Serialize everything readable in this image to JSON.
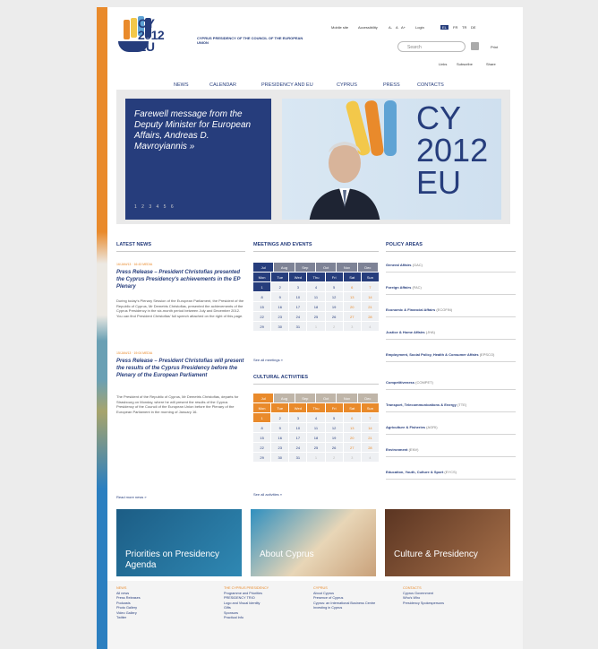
{
  "header": {
    "logo_text": "CY 2012 EU",
    "tagline": "CYPRUS PRESIDENCY OF THE COUNCIL OF THE EUROPEAN UNION",
    "util_links": [
      "Mobile site",
      "Accessibility",
      "A-",
      "A",
      "A+",
      "Login",
      "EL",
      "FR",
      "TR",
      "DE"
    ],
    "search_placeholder": "Search",
    "print_label": "Print",
    "sub_links": [
      "Links",
      "Subscribe",
      "Share"
    ]
  },
  "nav": [
    "NEWS",
    "CALENDAR",
    "PRESIDENCY AND EU",
    "CYPRUS",
    "PRESS",
    "CONTACTS"
  ],
  "hero": {
    "title": "Farewell message from the Deputy Minister for European Affairs, Andreas D. Mavroyiannis »",
    "pager": "1 2 3 4 5 6",
    "badge": "CY 2012 EU"
  },
  "latest_news": {
    "heading": "LATEST NEWS",
    "items": [
      {
        "date": "16/JAN/13 · 16:43 MEDIA",
        "title": "Press Release – President Christofias presented the Cyprus Presidency's achievements in the EP Plenary",
        "body": "During today's Plenary Session of the European Parliament, the President of the Republic of Cyprus, Mr Demetris Christofias, presented the achievements of the Cyprus Presidency in the six-month period between July and December 2012. You can find President Christofias' full speech attached on the right of this page."
      },
      {
        "date": "15/JAN/13 · 19:04 MEDIA",
        "title": "Press Release – President Christofias will present the results of the Cyprus Presidency before the Plenary of the European Parliament",
        "body": "The President of the Republic of Cyprus, Mr Demetris Christofias, departs for Strasbourg on Monday, where he will present the results of the Cyprus Presidency of the Council of the European Union before the Plenary of the European Parliament in the morning of January 16."
      }
    ],
    "read_more": "Read more news »"
  },
  "meetings": {
    "heading": "MEETINGS AND EVENTS",
    "months": [
      "Jul",
      "Aug",
      "Sep",
      "Oct",
      "Nov",
      "Dec"
    ],
    "days": [
      "Mon",
      "Tue",
      "Wed",
      "Thu",
      "Fri",
      "Sat",
      "Sun"
    ],
    "cells": [
      "1",
      "2",
      "3",
      "4",
      "5",
      "6",
      "7",
      "8",
      "9",
      "10",
      "11",
      "12",
      "13",
      "14",
      "15",
      "16",
      "17",
      "18",
      "19",
      "20",
      "21",
      "22",
      "23",
      "24",
      "25",
      "26",
      "27",
      "28",
      "29",
      "30",
      "31",
      "1",
      "2",
      "3",
      "4"
    ],
    "see_all": "See all meetings »"
  },
  "cultural": {
    "heading": "CULTURAL ACTIVITIES",
    "months": [
      "Jul",
      "Aug",
      "Sep",
      "Oct",
      "Nov",
      "Dec"
    ],
    "days": [
      "Mon",
      "Tue",
      "Wed",
      "Thu",
      "Fri",
      "Sat",
      "Sun"
    ],
    "cells": [
      "1",
      "2",
      "3",
      "4",
      "5",
      "6",
      "7",
      "8",
      "9",
      "10",
      "11",
      "12",
      "13",
      "14",
      "15",
      "16",
      "17",
      "18",
      "19",
      "20",
      "21",
      "22",
      "23",
      "24",
      "25",
      "26",
      "27",
      "28",
      "29",
      "30",
      "31",
      "1",
      "2",
      "3",
      "4"
    ],
    "see_all": "See all activities »"
  },
  "policy": {
    "heading": "POLICY AREAS",
    "items": [
      {
        "name": "General Affairs",
        "code": "(GAC)"
      },
      {
        "name": "Foreign Affairs",
        "code": "(FAC)"
      },
      {
        "name": "Economic & Financial Affairs",
        "code": "(ECOFIN)"
      },
      {
        "name": "Justice & Home Affairs",
        "code": "(JHA)"
      },
      {
        "name": "Employment, Social Policy, Health & Consumer Affairs",
        "code": "(EPSCO)"
      },
      {
        "name": "Competitiveness",
        "code": "(COMPET)"
      },
      {
        "name": "Transport, Telecommunications & Energy",
        "code": "(TTE)"
      },
      {
        "name": "Agriculture & Fisheries",
        "code": "(AGRI)"
      },
      {
        "name": "Environment",
        "code": "(ENV)"
      },
      {
        "name": "Education, Youth, Culture & Sport",
        "code": "(EYCS)"
      }
    ]
  },
  "tiles": [
    {
      "label": "Priorities on Presidency Agenda",
      "color": "#1f6e9a"
    },
    {
      "label": "About Cyprus",
      "color": "#c9b89a"
    },
    {
      "label": "Culture & Presidency",
      "color": "#8a5a3a"
    }
  ],
  "footer": {
    "cols": [
      {
        "title": "NEWS",
        "links": [
          "All news",
          "Press Releases",
          "Podcasts",
          "Photo Gallery",
          "Video Gallery",
          "Twitter"
        ]
      },
      {
        "title": "THE CYPRUS PRESIDENCY",
        "links": [
          "Programme and Priorities",
          "PRESIDENCY TRIO",
          "Logo and Visual Identity",
          "Gifts",
          "Sponsors",
          "Practical Info"
        ]
      },
      {
        "title": "CYPRUS",
        "links": [
          "About Cyprus",
          "Presence of Cyprus",
          "Cyprus: an International Business Centre",
          "Investing in Cyprus"
        ]
      },
      {
        "title": "CONTACTS",
        "links": [
          "Cyprus Government",
          "Who's Who",
          "Presidency Spokespersons"
        ]
      }
    ]
  },
  "colors": {
    "brand": "#263d7c",
    "accent": "#e98a2b"
  }
}
